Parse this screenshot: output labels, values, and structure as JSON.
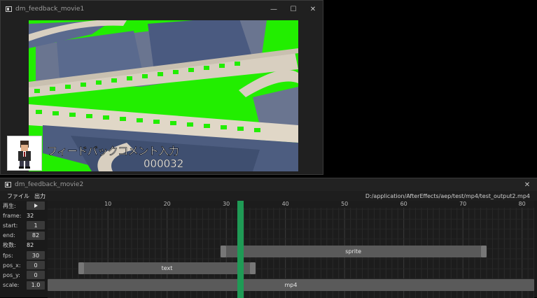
{
  "window1": {
    "title": "dm_feedback_movie1",
    "controls": {
      "minimize": "—",
      "maximize": "☐",
      "close": "✕"
    },
    "caption": "フィードバックコメント入力",
    "counter": "000032",
    "colors": {
      "chroma": "#22ee00"
    }
  },
  "window2": {
    "title": "dm_feedback_movie2",
    "close": "✕",
    "menu": [
      "ファイル",
      "出力"
    ],
    "path": "D:/application/AfterEffects/aep/test/mp4/test_output2.mp4",
    "params": [
      {
        "label": "再生:",
        "kind": "play",
        "value": ""
      },
      {
        "label": "frame:",
        "kind": "plain",
        "value": "32"
      },
      {
        "label": "start:",
        "kind": "box",
        "value": "1"
      },
      {
        "label": "end:",
        "kind": "box",
        "value": "82"
      },
      {
        "label": "枚数:",
        "kind": "plain",
        "value": "82"
      },
      {
        "label": "fps:",
        "kind": "box",
        "value": "30"
      },
      {
        "label": "pos_x:",
        "kind": "box",
        "value": "0"
      },
      {
        "label": "pos_y:",
        "kind": "box",
        "value": "0"
      },
      {
        "label": "scale:",
        "kind": "box",
        "value": "1.0"
      }
    ],
    "timeline": {
      "ruler_labels": [
        "10",
        "20",
        "30",
        "40",
        "50",
        "60",
        "70",
        "80"
      ],
      "current_frame": 32,
      "clips": [
        {
          "name": "sprite",
          "start": 29,
          "end": 73,
          "row": 0
        },
        {
          "name": "text",
          "start": 5,
          "end": 34,
          "row": 1
        },
        {
          "name": "mp4",
          "start": 1,
          "end": 82,
          "row": 2
        }
      ],
      "colors": {
        "playhead": "#1f9a55",
        "clip": "#5a5a5a"
      }
    }
  }
}
